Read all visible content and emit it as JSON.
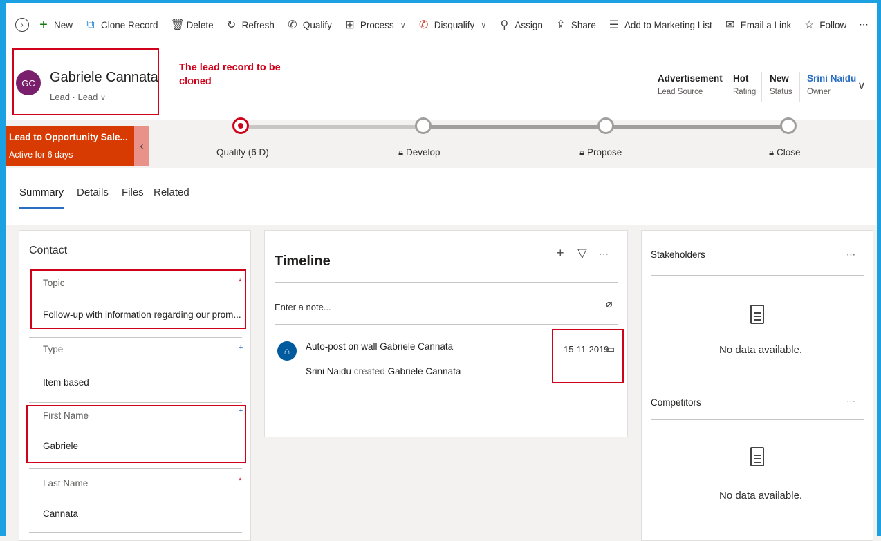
{
  "commands": {
    "new": "New",
    "clone": "Clone Record",
    "delete": "Delete",
    "refresh": "Refresh",
    "qualify": "Qualify",
    "process": "Process",
    "disqualify": "Disqualify",
    "assign": "Assign",
    "share": "Share",
    "marketing": "Add to Marketing List",
    "email_link": "Email a Link",
    "follow": "Follow",
    "more": "⋯"
  },
  "header": {
    "avatar_initials": "GC",
    "name": "Gabriele Cannata",
    "entity": "Lead · Lead",
    "annotation": "The lead record  to be cloned",
    "fields": [
      {
        "value": "Advertisement",
        "label": "Lead Source"
      },
      {
        "value": "Hot",
        "label": "Rating"
      },
      {
        "value": "New",
        "label": "Status"
      },
      {
        "value": "Srini Naidu",
        "label": "Owner"
      }
    ]
  },
  "process": {
    "name": "Lead to Opportunity Sale...",
    "active_for": "Active for 6 days",
    "stages": [
      "Qualify  (6 D)",
      "Develop",
      "Propose",
      "Close"
    ]
  },
  "tabs": [
    "Summary",
    "Details",
    "Files",
    "Related"
  ],
  "contact": {
    "title": "Contact",
    "fields": [
      {
        "label": "Topic",
        "value": "Follow-up with information regarding our prom..."
      },
      {
        "label": "Type",
        "value": "Item based"
      },
      {
        "label": "First Name",
        "value": "Gabriele"
      },
      {
        "label": "Last Name",
        "value": "Cannata"
      }
    ]
  },
  "timeline": {
    "title": "Timeline",
    "note_placeholder": "Enter a note...",
    "post": {
      "title": "Auto-post on wall Gabriele Cannata",
      "actor": "Srini Naidu",
      "verb": "created",
      "target": "Gabriele Cannata",
      "date": "15-11-2019"
    }
  },
  "stakeholders": {
    "title": "Stakeholders",
    "empty": "No data available."
  },
  "competitors": {
    "title": "Competitors",
    "empty": "No data available."
  }
}
